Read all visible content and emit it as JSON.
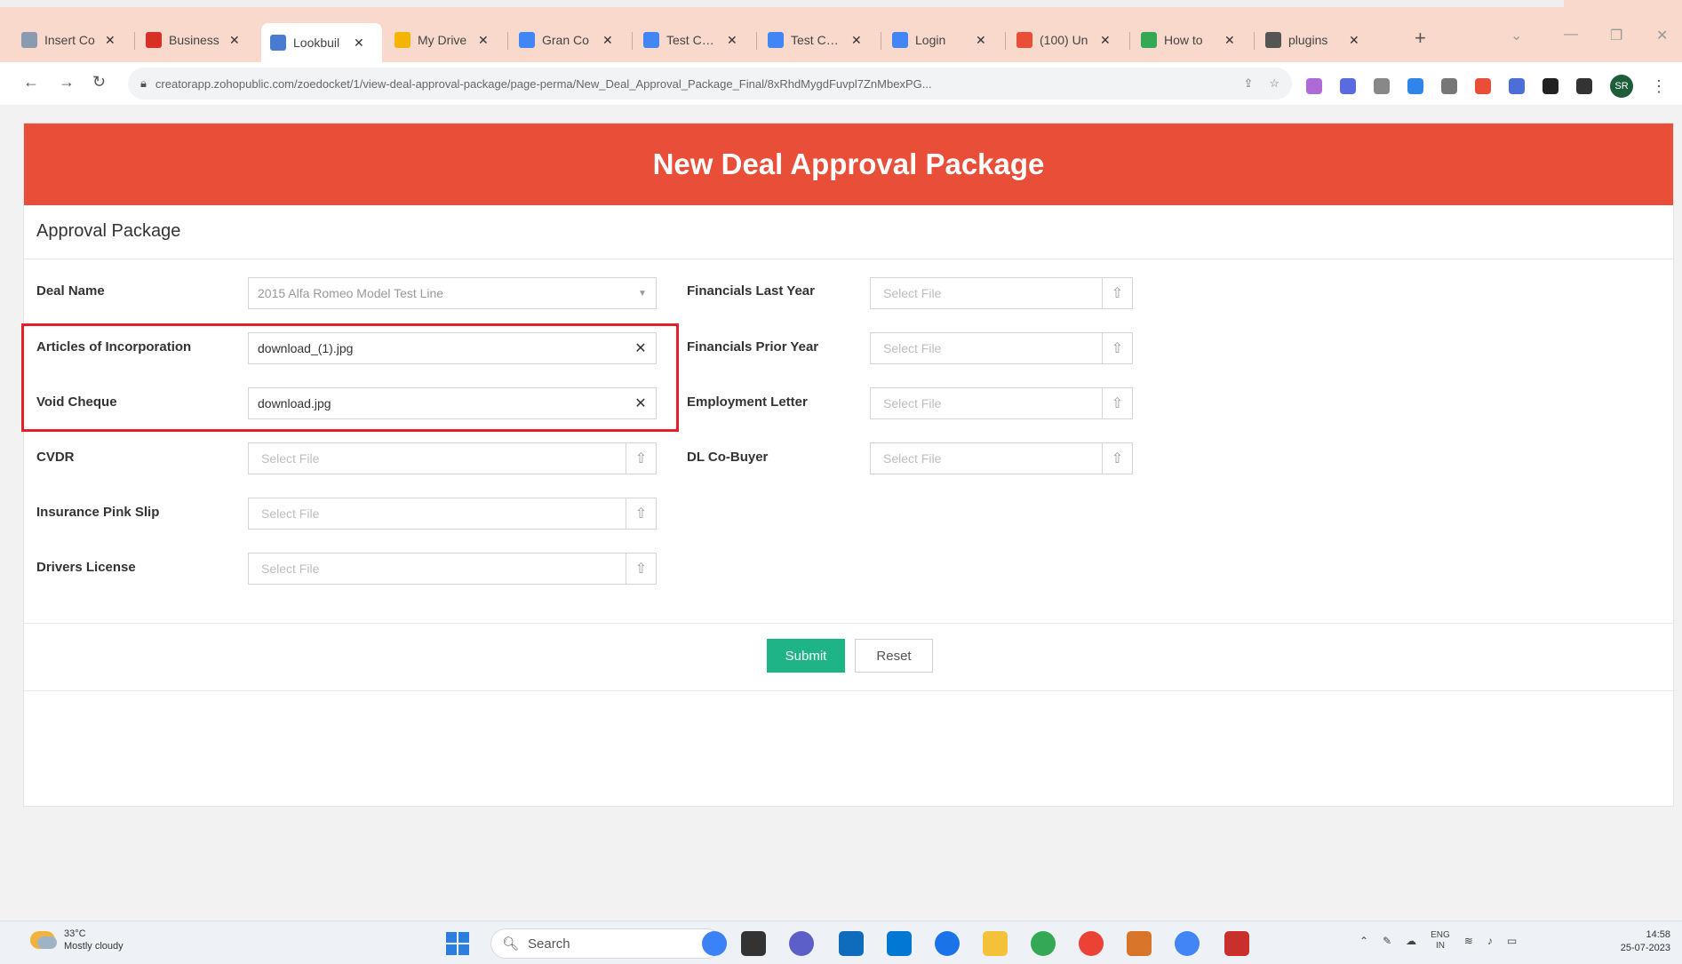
{
  "browser": {
    "tabs": [
      {
        "title": "Insert Co",
        "icon": "doc-icon",
        "color": "#8a9bb0",
        "active": false
      },
      {
        "title": "Business",
        "icon": "gmail-icon",
        "color": "#d93025",
        "active": false
      },
      {
        "title": "Lookbuil",
        "icon": "gear-icon",
        "color": "#4a7bd0",
        "active": true
      },
      {
        "title": "My Drive",
        "icon": "drive-icon",
        "color": "#f4b400",
        "active": false
      },
      {
        "title": "Gran Co",
        "icon": "doc-icon",
        "color": "#4285f4",
        "active": false
      },
      {
        "title": "Test Case",
        "icon": "doc-icon",
        "color": "#4285f4",
        "active": false
      },
      {
        "title": "Test Case",
        "icon": "doc-icon",
        "color": "#4285f4",
        "active": false
      },
      {
        "title": "Login",
        "icon": "doc-icon",
        "color": "#4285f4",
        "active": false
      },
      {
        "title": "(100) Un",
        "icon": "pin-icon",
        "color": "#e94e39",
        "active": false
      },
      {
        "title": "How to",
        "icon": "google-icon",
        "color": "#34a853",
        "active": false
      },
      {
        "title": "plugins",
        "icon": "wp-icon",
        "color": "#555555",
        "active": false
      }
    ],
    "new_tab": "+",
    "url": "creatorapp.zohopublic.com/zoedocket/1/view-deal-approval-package/page-perma/New_Deal_Approval_Package_Final/8xRhdMygdFuvpl7ZnMbexPG..."
  },
  "form": {
    "title": "New Deal Approval Package",
    "section": "Approval Package",
    "left_fields": [
      {
        "label": "Deal Name",
        "type": "select",
        "value": "2015 Alfa Romeo Model Test Line"
      },
      {
        "label": "Articles of Incorporation",
        "type": "file-filled",
        "value": "download_(1).jpg"
      },
      {
        "label": "Void Cheque",
        "type": "file-filled",
        "value": "download.jpg"
      },
      {
        "label": "CVDR",
        "type": "file-empty",
        "placeholder": "Select File"
      },
      {
        "label": "Insurance Pink Slip",
        "type": "file-empty",
        "placeholder": "Select File"
      },
      {
        "label": "Drivers License",
        "type": "file-empty",
        "placeholder": "Select File"
      }
    ],
    "right_fields": [
      {
        "label": "Financials Last Year",
        "type": "file-empty",
        "placeholder": "Select File"
      },
      {
        "label": "Financials Prior Year",
        "type": "file-empty",
        "placeholder": "Select File"
      },
      {
        "label": "Employment Letter",
        "type": "file-empty",
        "placeholder": "Select File"
      },
      {
        "label": "DL Co-Buyer",
        "type": "file-empty",
        "placeholder": "Select File"
      }
    ],
    "submit_label": "Submit",
    "reset_label": "Reset",
    "header_color": "#e94e39",
    "submit_color": "#1fb388",
    "highlight_color": "#e21f2b"
  },
  "taskbar": {
    "weather_temp": "33°C",
    "weather_desc": "Mostly cloudy",
    "search_placeholder": "Search",
    "lang_line1": "ENG",
    "lang_line2": "IN",
    "time": "14:58",
    "date": "25-07-2023"
  }
}
